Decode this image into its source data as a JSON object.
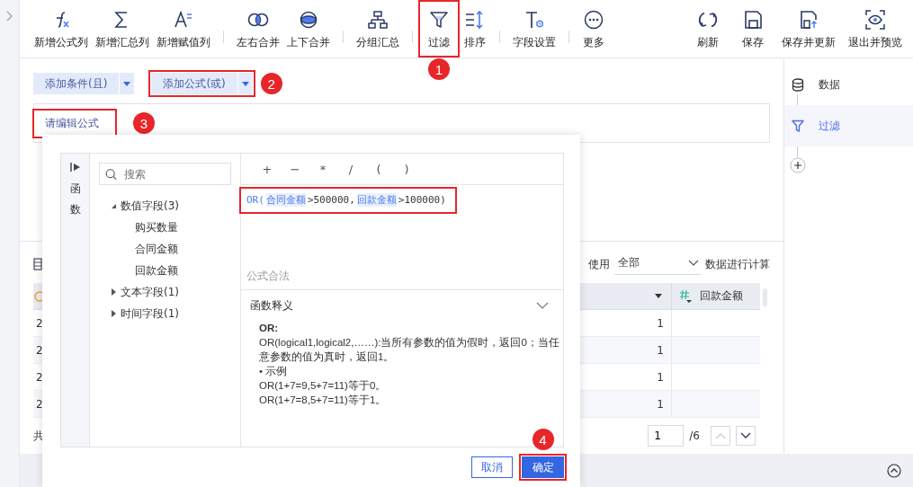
{
  "toolbar": {
    "groups": [
      {
        "items": [
          {
            "label": "新增公式列",
            "kind": "formula"
          },
          {
            "label": "新增汇总列",
            "kind": "sum"
          },
          {
            "label": "新增赋值列",
            "kind": "assign"
          }
        ]
      },
      {
        "items": [
          {
            "label": "左右合并",
            "kind": "merge-lr"
          },
          {
            "label": "上下合并",
            "kind": "merge-tb"
          }
        ]
      },
      {
        "items": [
          {
            "label": "分组汇总",
            "kind": "group"
          }
        ]
      },
      {
        "items": [
          {
            "label": "过滤",
            "kind": "filter",
            "callout": "1"
          },
          {
            "label": "排序",
            "kind": "sort"
          }
        ]
      },
      {
        "items": [
          {
            "label": "字段设置",
            "kind": "field"
          }
        ]
      },
      {
        "items": [
          {
            "label": "更多",
            "kind": "more"
          }
        ]
      }
    ],
    "right_items": [
      {
        "label": "刷新",
        "kind": "refresh"
      },
      {
        "label": "保存",
        "kind": "save"
      },
      {
        "label": "保存并更新",
        "kind": "save-update"
      },
      {
        "label": "退出并预览",
        "kind": "preview"
      }
    ]
  },
  "filter_buttons": [
    {
      "label": "添加条件(且)"
    },
    {
      "label": "添加公式(或)",
      "callout": "2"
    }
  ],
  "formula_field": {
    "placeholder": "请编辑公式",
    "callout": "3"
  },
  "table": {
    "calc_scope": {
      "prefix": "使用",
      "value": "全部",
      "suffix": "数据进行计算"
    },
    "columns": [
      {
        "label": "回款金额"
      }
    ],
    "rows": [
      {
        "column_1": "2",
        "column_2": "1"
      },
      {
        "column_1": "2",
        "column_2": "1"
      },
      {
        "column_1": "2",
        "column_2": "1"
      },
      {
        "column_1": "2",
        "column_2": "1"
      }
    ],
    "footer": "共",
    "pagination": {
      "page": "1",
      "total": "/6"
    }
  },
  "steps": [
    {
      "label": "数据",
      "kind": "data",
      "selected": false
    },
    {
      "label": "过滤",
      "kind": "filter",
      "selected": true
    }
  ],
  "dialog": {
    "side_tab": "函数",
    "search": {
      "placeholder": "搜索"
    },
    "field_tree": [
      {
        "label": "数值字段(3)",
        "expanded": true,
        "children": [
          {
            "label": "购买数量"
          },
          {
            "label": "合同金额"
          },
          {
            "label": "回款金额"
          }
        ]
      },
      {
        "label": "文本字段(1)",
        "expanded": false
      },
      {
        "label": "时间字段(1)",
        "expanded": false
      }
    ],
    "operators": [
      "+",
      "−",
      "*",
      "/",
      "(",
      ")"
    ],
    "formula": {
      "highlighted": true,
      "tokens": [
        {
          "kind": "func",
          "text": "OR("
        },
        {
          "kind": "field",
          "text": "合同金额"
        },
        {
          "kind": "plain",
          "text": ">500000,"
        },
        {
          "kind": "field",
          "text": "回款金额"
        },
        {
          "kind": "plain",
          "text": ">100000)"
        }
      ]
    },
    "status": "公式合法",
    "help": {
      "title": "函数释义",
      "expanded": true,
      "heading": "OR:",
      "lines": [
        "OR(logical1,logical2,……):当所有参数的值为假时，返回0；当任意参数的值为真时，返回1。",
        "• 示例",
        "OR(1+7=9,5+7=11)等于0。",
        "OR(1+7=8,5+7=11)等于1。"
      ]
    },
    "buttons": [
      {
        "label": "取消",
        "kind": "secondary"
      },
      {
        "label": "确定",
        "kind": "primary",
        "callout": "4"
      }
    ]
  }
}
